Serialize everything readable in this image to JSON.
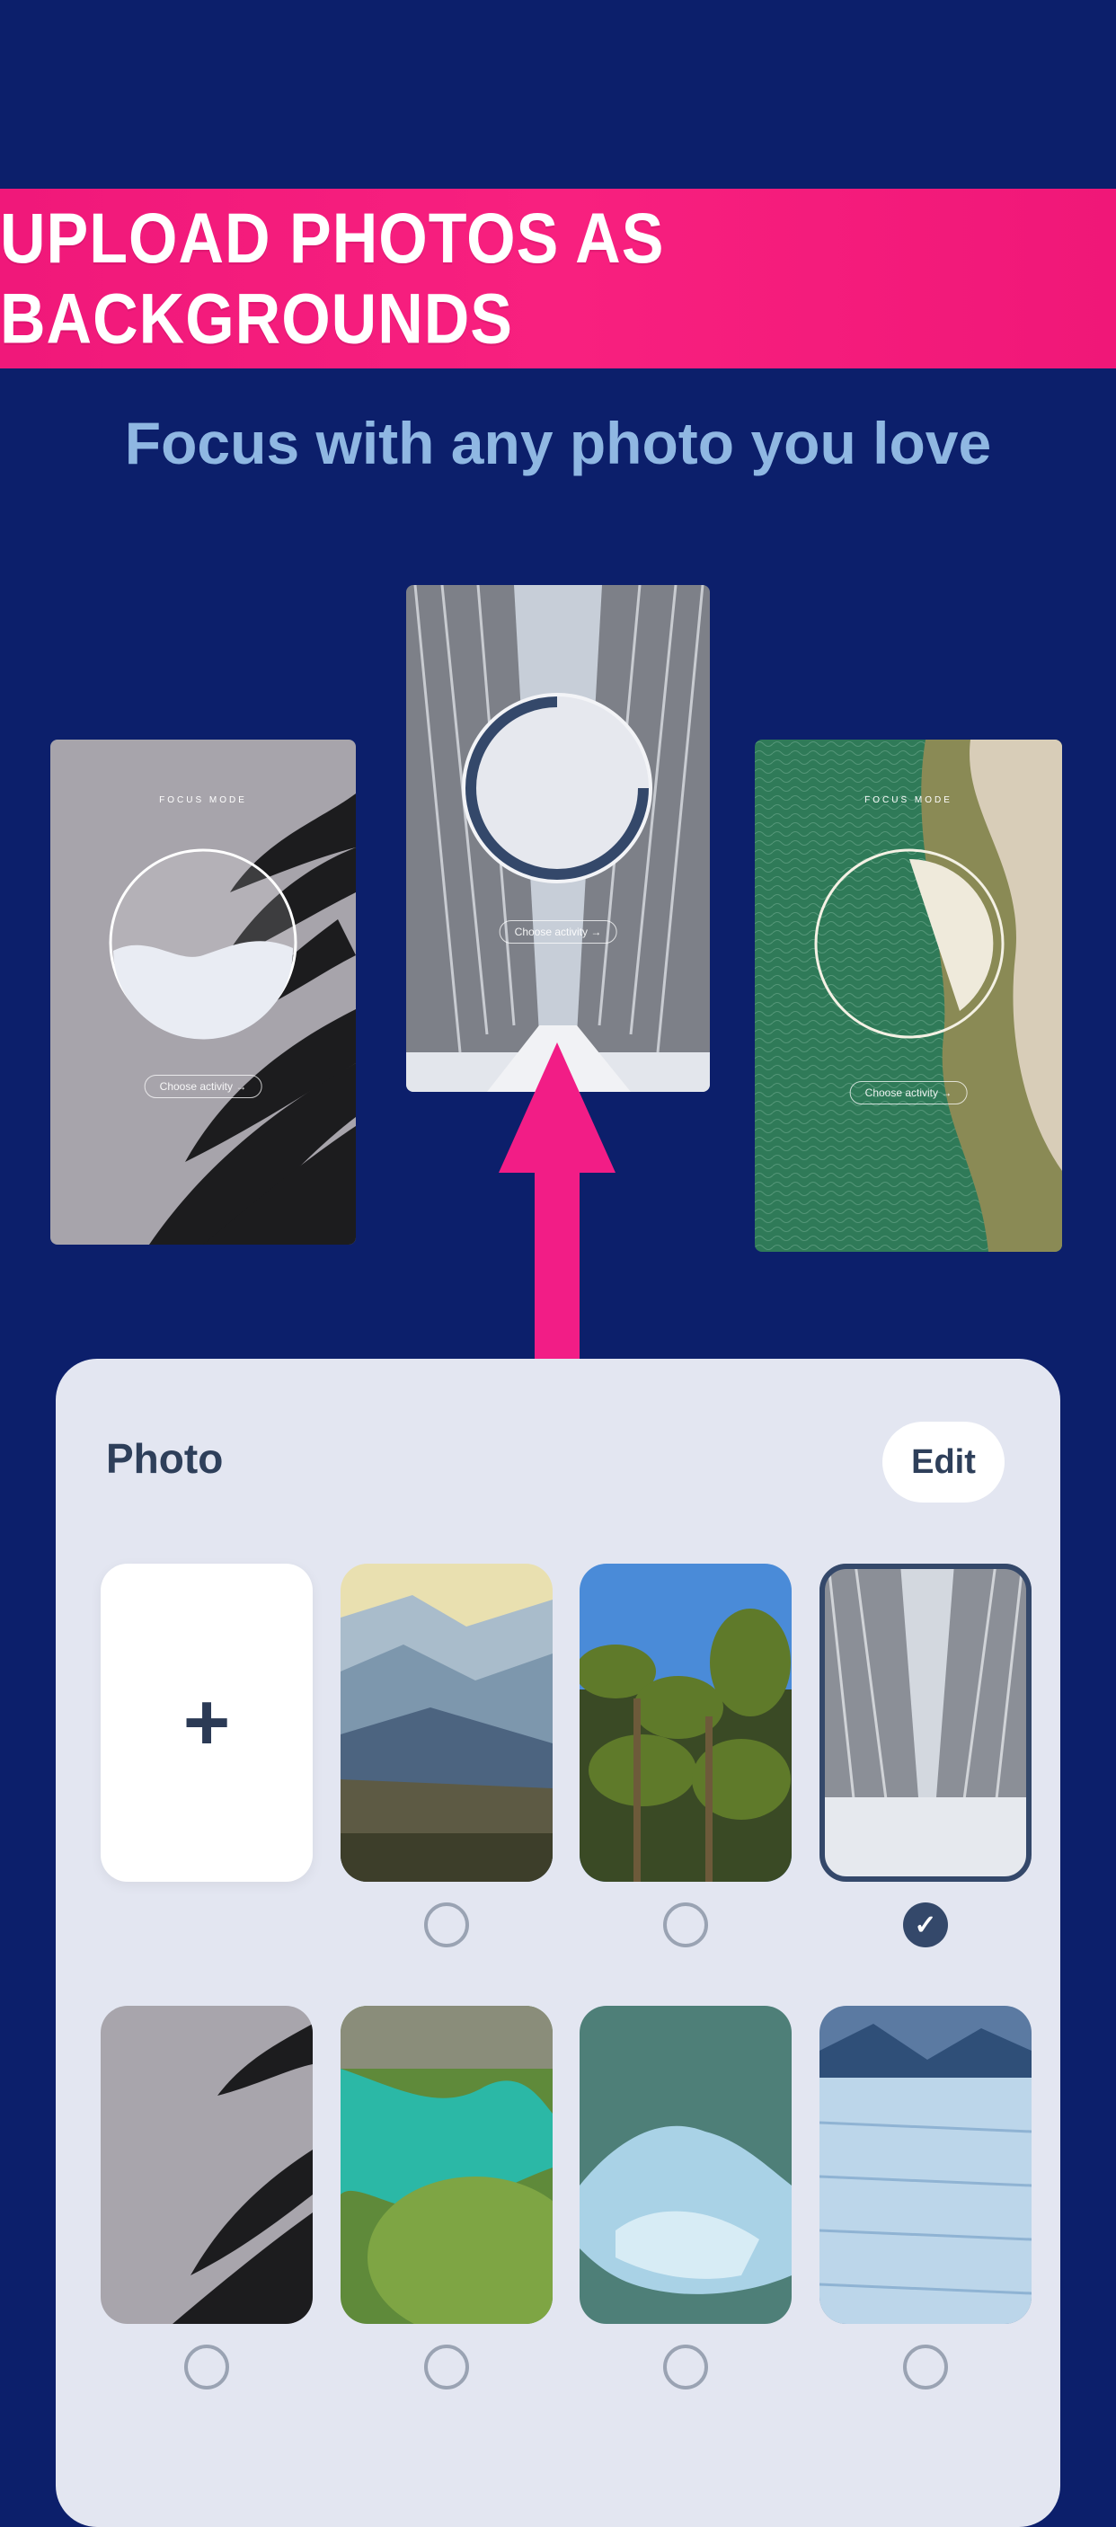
{
  "banner": {
    "text": "UPLOAD PHOTOS AS BACKGROUNDS"
  },
  "subtitle": "Focus with any photo you love",
  "previews": [
    {
      "caption": "FOCUS MODE",
      "pill": "Choose activity →"
    },
    {
      "caption": "",
      "pill": "Choose activity →"
    },
    {
      "caption": "FOCUS MODE",
      "pill": "Choose activity →"
    }
  ],
  "sheet": {
    "title": "Photo",
    "edit_label": "Edit",
    "add_icon": "+",
    "tiles": [
      {
        "name": "mountains",
        "selected": false
      },
      {
        "name": "palm-forest",
        "selected": false
      },
      {
        "name": "snowy-road",
        "selected": true
      },
      {
        "name": "palm-leaves",
        "selected": false
      },
      {
        "name": "green-river",
        "selected": false
      },
      {
        "name": "iceberg",
        "selected": false
      },
      {
        "name": "glacier",
        "selected": false
      }
    ],
    "check_mark": "✓"
  },
  "colors": {
    "background": "#0c1f6b",
    "banner": "#f8207f",
    "subtitle": "#8fb7e2",
    "sheet": "#e3e6f1",
    "accent": "#34486a"
  }
}
